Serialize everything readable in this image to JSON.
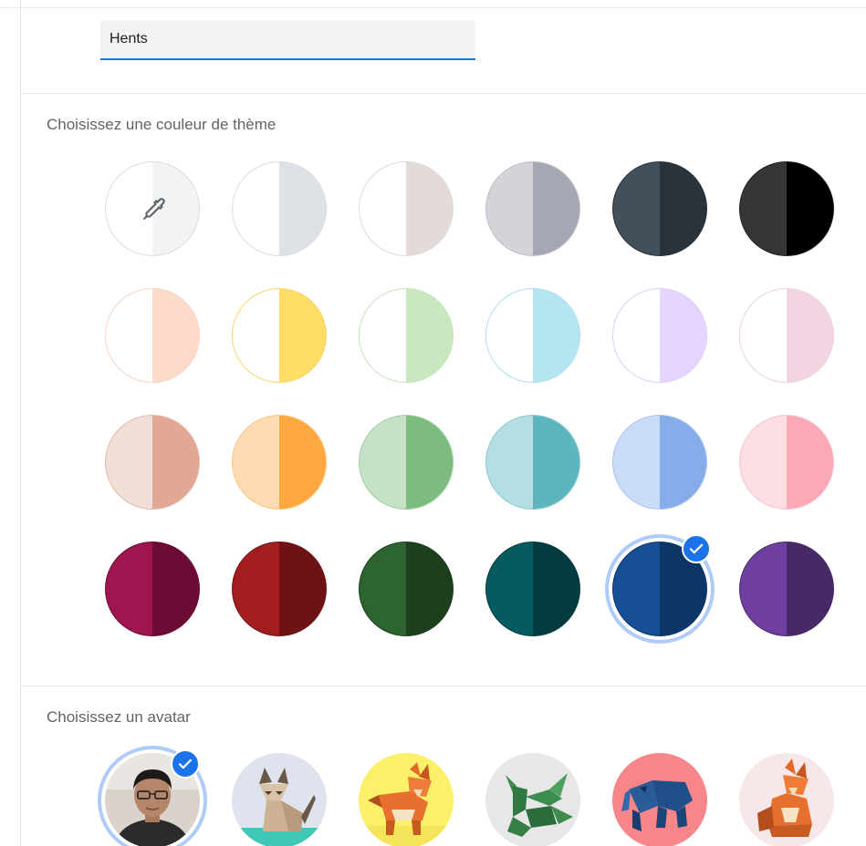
{
  "profile": {
    "name_value": "Hents"
  },
  "theme": {
    "title": "Choisissez une couleur de thème",
    "selected_index": 22,
    "swatches": [
      {
        "name": "custom-color",
        "left": "#ffffff",
        "right": "#f1f3f4",
        "border": "#dadce0",
        "icon": "eyedropper-icon"
      },
      {
        "name": "light-grey",
        "left": "#ffffff",
        "right": "#dee1e6",
        "border": "#dadce0"
      },
      {
        "name": "warm-grey",
        "left": "#ffffff",
        "right": "#e3dbd7",
        "border": "#e0dad7"
      },
      {
        "name": "cool-grey",
        "left": "#d3d4da",
        "right": "#a5a8b4",
        "border": "#bfc1c8"
      },
      {
        "name": "slate",
        "left": "#42505b",
        "right": "#293339",
        "border": "#293339"
      },
      {
        "name": "black",
        "left": "#363636",
        "right": "#000000",
        "border": "#202020"
      },
      {
        "name": "peach-light",
        "left": "#ffffff",
        "right": "#fcdbc9",
        "border": "#f6d3c1"
      },
      {
        "name": "yellow-light",
        "left": "#ffffff",
        "right": "#ffdc63",
        "border": "#f7d66a"
      },
      {
        "name": "green-light",
        "left": "#ffffff",
        "right": "#cae8c0",
        "border": "#c6e2bd"
      },
      {
        "name": "cyan-light",
        "left": "#ffffff",
        "right": "#b5e5f1",
        "border": "#b0dfec"
      },
      {
        "name": "lavender-light",
        "left": "#ffffff",
        "right": "#e6d5fe",
        "border": "#ddd0f6"
      },
      {
        "name": "pink-light",
        "left": "#ffffff",
        "right": "#f3d4e2",
        "border": "#ecd0dd"
      },
      {
        "name": "salmon",
        "left": "#f1ded8",
        "right": "#e1a895",
        "border": "#e4b9aa"
      },
      {
        "name": "orange",
        "left": "#fedbb3",
        "right": "#fda740",
        "border": "#fbc47c"
      },
      {
        "name": "green",
        "left": "#c5e1c6",
        "right": "#7cbc7e",
        "border": "#a2cfa3"
      },
      {
        "name": "teal",
        "left": "#b3dfe2",
        "right": "#5db6bf",
        "border": "#8bcbd0"
      },
      {
        "name": "blue-light",
        "left": "#c9dbf7",
        "right": "#86adea",
        "border": "#a9c4f0"
      },
      {
        "name": "pink",
        "left": "#fcdde2",
        "right": "#fba9b6",
        "border": "#f9c4cc"
      },
      {
        "name": "berry",
        "left": "#a0144f",
        "right": "#6c0c35",
        "border": "#6c0c35"
      },
      {
        "name": "red",
        "left": "#a31c1e",
        "right": "#6e1213",
        "border": "#6e1213"
      },
      {
        "name": "forest",
        "left": "#2d6430",
        "right": "#1c3f1d",
        "border": "#1c3f1d"
      },
      {
        "name": "dark-teal",
        "left": "#065b5f",
        "right": "#043b3e",
        "border": "#043b3e"
      },
      {
        "name": "navy",
        "left": "#164f96",
        "right": "#0d3566",
        "border": "#0d3566"
      },
      {
        "name": "purple",
        "left": "#6e3fa0",
        "right": "#482967",
        "border": "#482967"
      }
    ]
  },
  "avatar": {
    "title": "Choisissez un avatar",
    "selected_index": 0,
    "items": [
      {
        "name": "avatar-photo"
      },
      {
        "name": "avatar-origami-cat"
      },
      {
        "name": "avatar-origami-fox-yellow"
      },
      {
        "name": "avatar-origami-dragon"
      },
      {
        "name": "avatar-origami-elephant"
      },
      {
        "name": "avatar-origami-fox"
      }
    ]
  },
  "colors": {
    "accent": "#1a73e8",
    "selection_ring": "#aecbfa",
    "section_text": "#5f6368"
  }
}
